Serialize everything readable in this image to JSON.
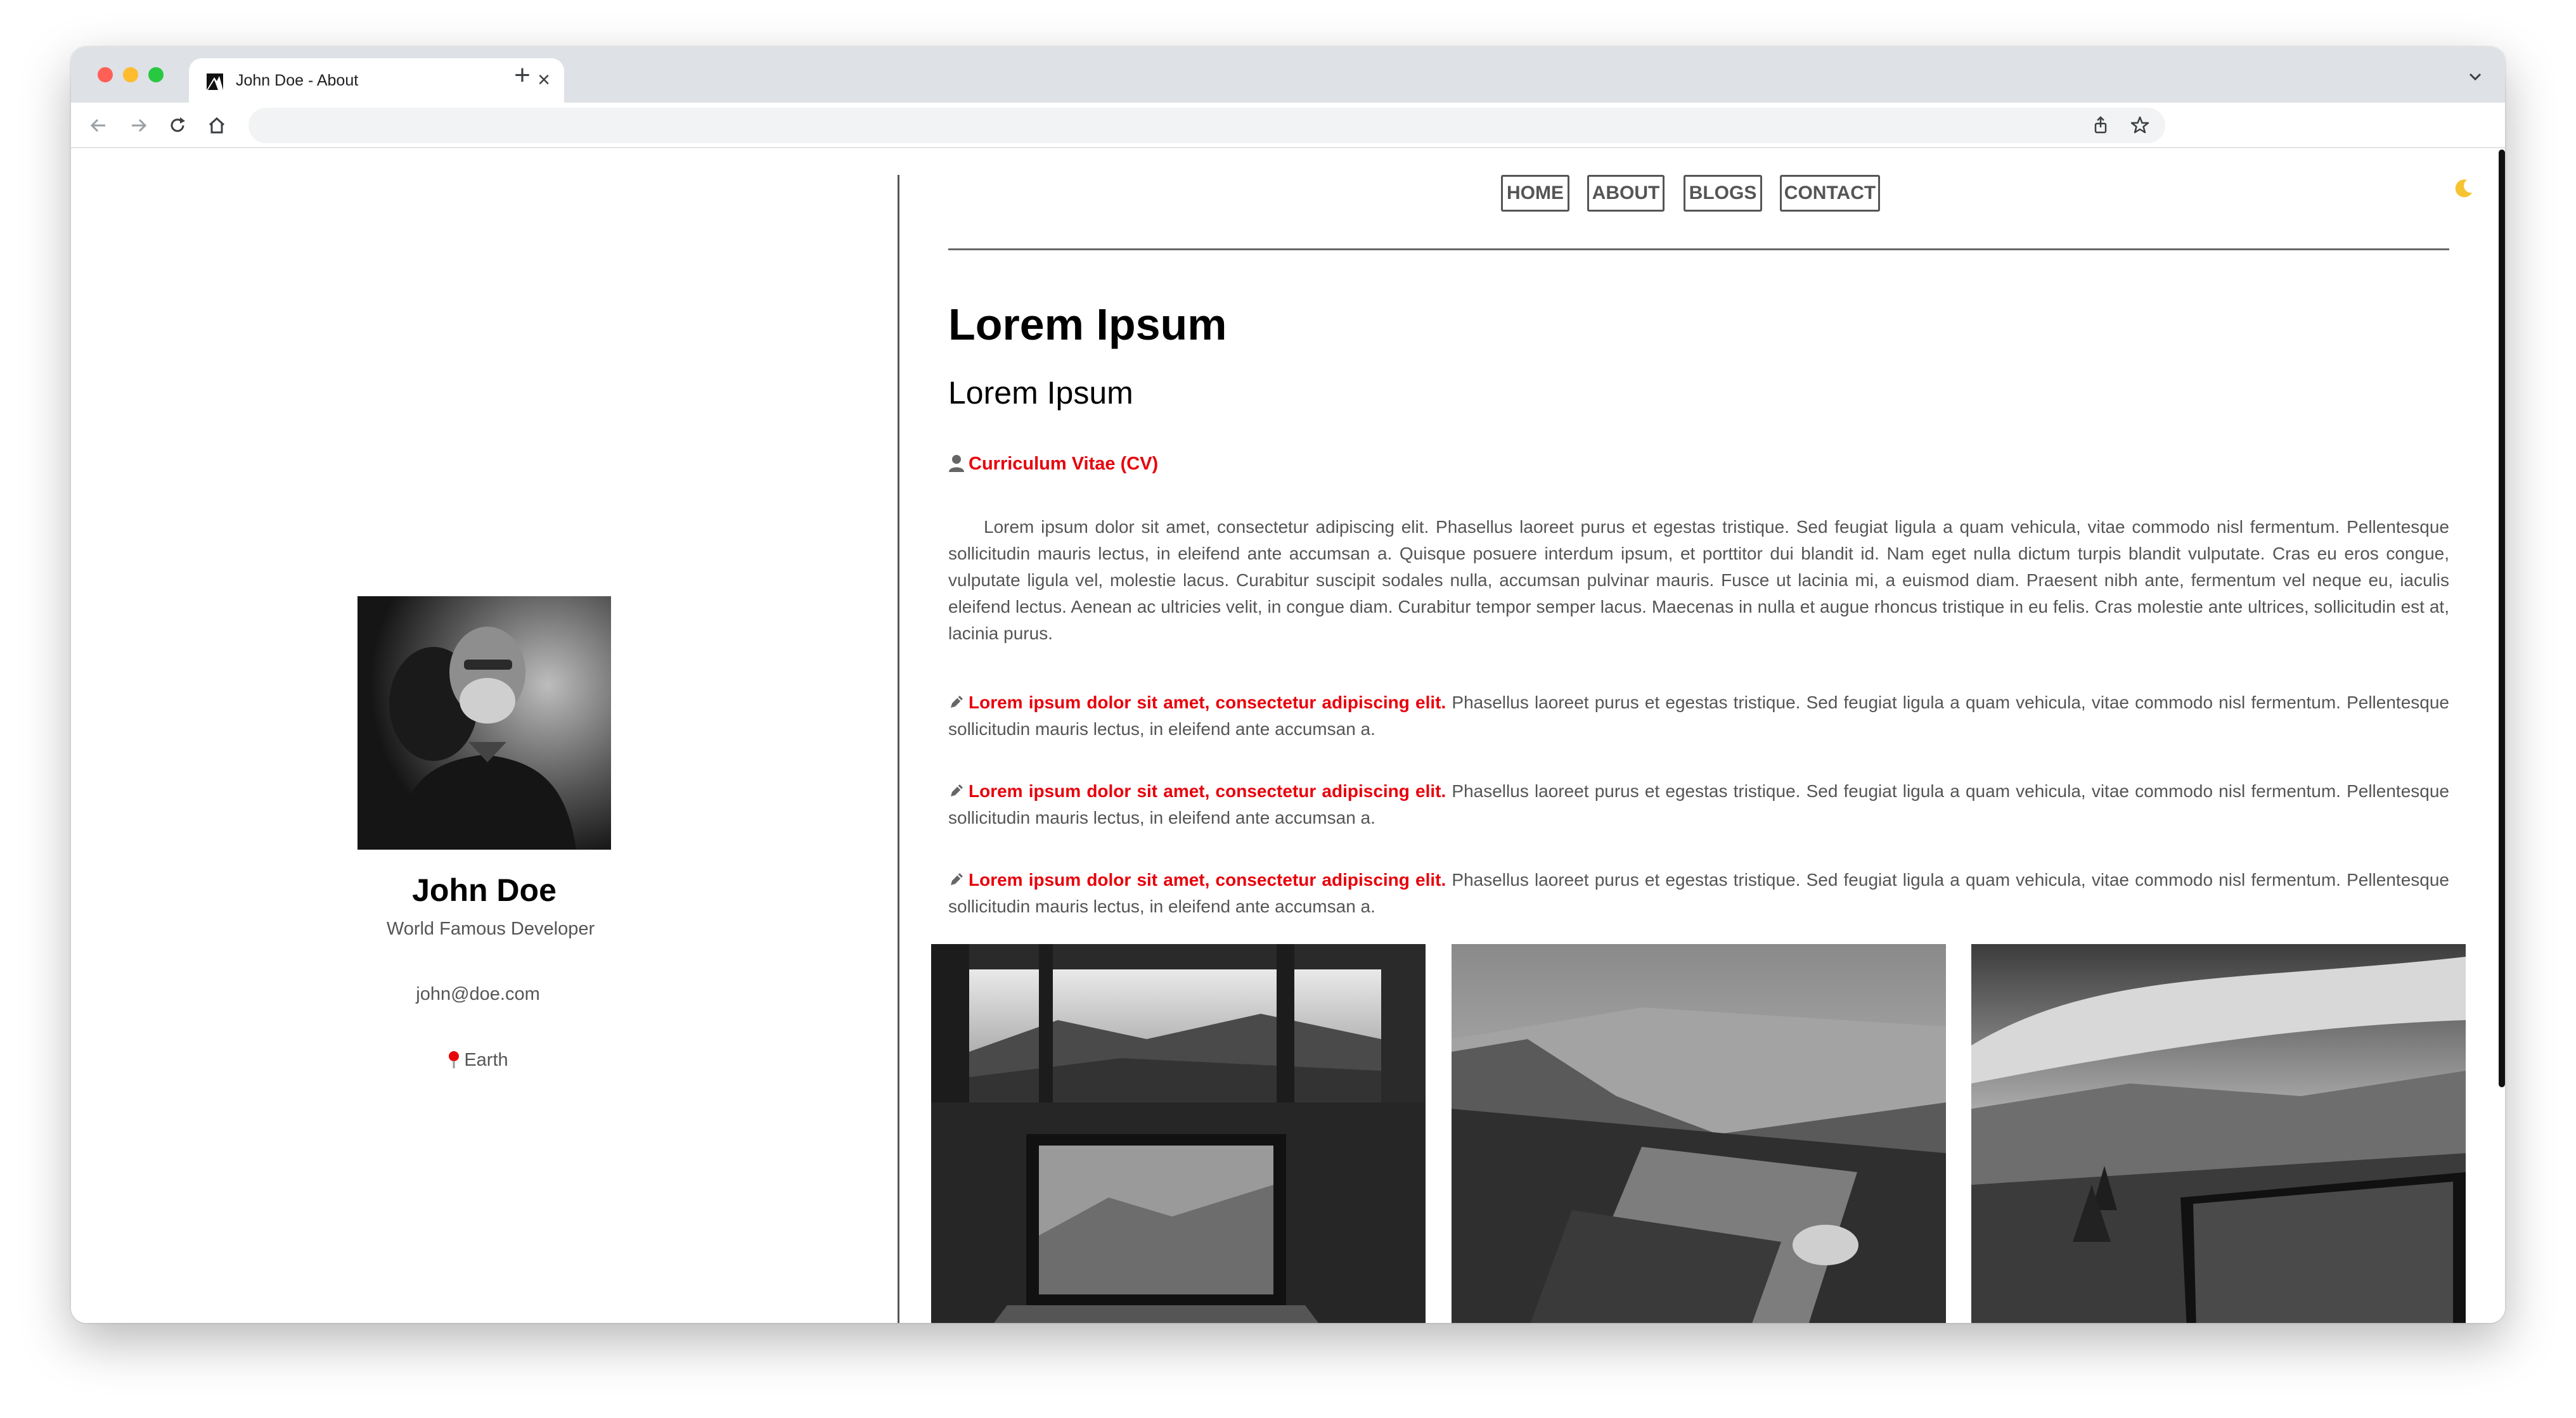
{
  "browser": {
    "tab_title": "John Doe - About",
    "new_tab_label": "+",
    "close_tab_label": "×",
    "url": ""
  },
  "nav": {
    "items": [
      {
        "label": "HOME"
      },
      {
        "label": "ABOUT"
      },
      {
        "label": "BLOGS"
      },
      {
        "label": "CONTACT"
      }
    ]
  },
  "profile": {
    "name": "John Doe",
    "role": "World Famous Developer",
    "email": "john@doe.com",
    "location": "Earth"
  },
  "main": {
    "title": "Lorem Ipsum",
    "subtitle": "Lorem Ipsum",
    "cv_link": "Curriculum Vitae (CV)",
    "intro": "Lorem ipsum dolor sit amet, consectetur adipiscing elit. Phasellus laoreet purus et egestas tristique. Sed feugiat ligula a quam vehicula, vitae commodo nisl fermentum. Pellentesque sollicitudin mauris lectus, in eleifend ante accumsan a. Quisque posuere interdum ipsum, et porttitor dui blandit id. Nam eget nulla dictum turpis blandit vulputate. Cras eu eros congue, vulputate ligula vel, molestie lacus. Curabitur suscipit sodales nulla, accumsan pulvinar mauris. Fusce ut lacinia mi, a euismod diam. Praesent nibh ante, fermentum vel neque eu, iaculis eleifend lectus. Aenean ac ultricies velit, in congue diam. Curabitur tempor semper lacus. Maecenas in nulla et augue rhoncus tristique in eu felis. Cras molestie ante ultrices, sollicitudin est at, lacinia purus.",
    "items": [
      {
        "heading": "Lorem ipsum dolor sit amet, consectetur adipiscing elit.",
        "text": " Phasellus laoreet purus et egestas tristique. Sed feugiat ligula a quam vehicula, vitae commodo nisl fermentum. Pellentesque sollicitudin mauris lectus, in eleifend ante accumsan a."
      },
      {
        "heading": "Lorem ipsum dolor sit amet, consectetur adipiscing elit.",
        "text": " Phasellus laoreet purus et egestas tristique. Sed feugiat ligula a quam vehicula, vitae commodo nisl fermentum. Pellentesque sollicitudin mauris lectus, in eleifend ante accumsan a."
      },
      {
        "heading": "Lorem ipsum dolor sit amet, consectetur adipiscing elit.",
        "text": " Phasellus laoreet purus et egestas tristique. Sed feugiat ligula a quam vehicula, vitae commodo nisl fermentum. Pellentesque sollicitudin mauris lectus, in eleifend ante accumsan a."
      }
    ]
  },
  "icons": {
    "theme_toggle": "moon-icon",
    "cv": "user-icon",
    "item": "pencil-icon",
    "location": "pin-icon"
  },
  "colors": {
    "accent": "#e8000b",
    "text_muted": "#555555",
    "tabbar": "#dee1e6"
  }
}
